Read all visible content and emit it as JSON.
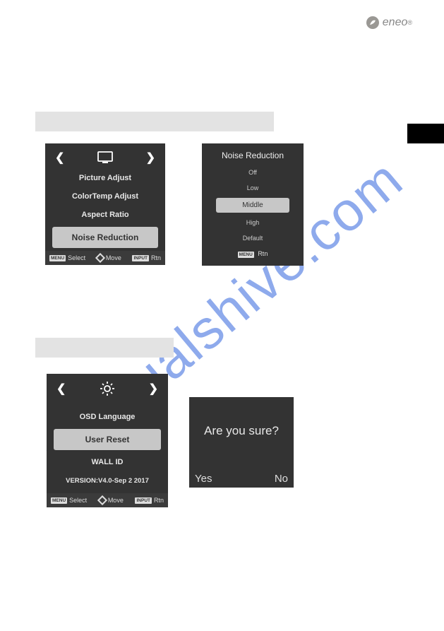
{
  "brand": "eneo",
  "watermark": "manualshive.com",
  "panel1": {
    "items": [
      "Picture Adjust",
      "ColorTemp Adjust",
      "Aspect Ratio",
      "Noise Reduction"
    ],
    "selected_index": 3,
    "footer": {
      "menu_tag": "MENU",
      "select": "Select",
      "move": "Move",
      "input_tag": "INPUT",
      "rtn": "Rtn"
    }
  },
  "panel2": {
    "title": "Noise Reduction",
    "options": [
      "Off",
      "Low",
      "Middle",
      "High",
      "Default"
    ],
    "selected_index": 2,
    "rtn_tag": "MENU",
    "rtn": "Rtn"
  },
  "panel3": {
    "items": [
      "OSD Language",
      "User Reset",
      "WALL ID"
    ],
    "selected_index": 1,
    "version": "VERSION:V4.0-Sep   2 2017",
    "footer": {
      "menu_tag": "MENU",
      "select": "Select",
      "move": "Move",
      "input_tag": "INPUT",
      "rtn": "Rtn"
    }
  },
  "confirm": {
    "question": "Are you sure?",
    "yes": "Yes",
    "no": "No"
  }
}
